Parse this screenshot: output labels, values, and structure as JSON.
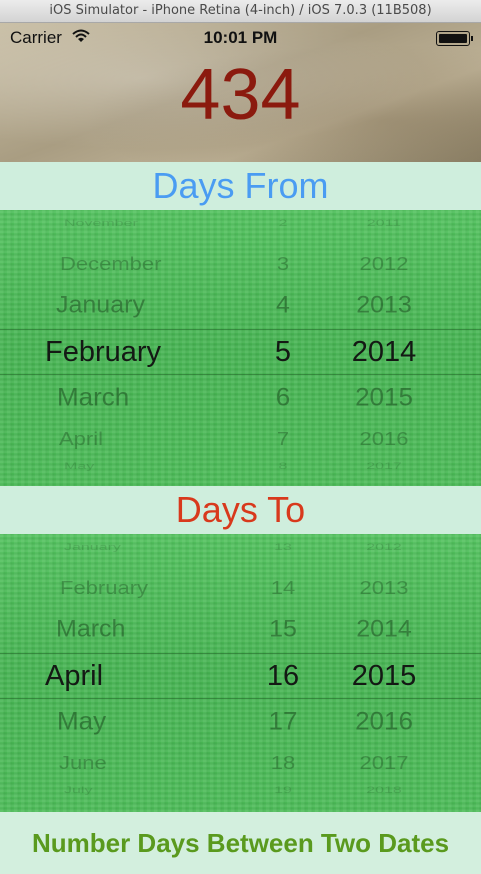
{
  "window": {
    "title": "iOS Simulator - iPhone Retina (4-inch) / iOS 7.0.3 (11B508)"
  },
  "status_bar": {
    "carrier": "Carrier",
    "time": "10:01 PM"
  },
  "result": {
    "days": "434"
  },
  "from_section": {
    "label": "Days From",
    "months": [
      "November",
      "December",
      "January",
      "February",
      "March",
      "April",
      "May"
    ],
    "days": [
      "2",
      "3",
      "4",
      "5",
      "6",
      "7",
      "8"
    ],
    "years": [
      "2011",
      "2012",
      "2013",
      "2014",
      "2015",
      "2016",
      "2017"
    ],
    "selected": {
      "month": "February",
      "day": "5",
      "year": "2014"
    }
  },
  "to_section": {
    "label": "Days To",
    "months": [
      "January",
      "February",
      "March",
      "April",
      "May",
      "June",
      "July"
    ],
    "days": [
      "13",
      "14",
      "15",
      "16",
      "17",
      "18",
      "19"
    ],
    "years": [
      "2012",
      "2013",
      "2014",
      "2015",
      "2016",
      "2017",
      "2018"
    ],
    "selected": {
      "month": "April",
      "day": "16",
      "year": "2015"
    }
  },
  "footer": {
    "title": "Number Days Between Two Dates"
  },
  "colors": {
    "days_from": "#4a9cf2",
    "days_to": "#d8391c",
    "counter": "#8b1a0e",
    "footer_text": "#5a9a1e",
    "picker_green": "#4cb958"
  }
}
